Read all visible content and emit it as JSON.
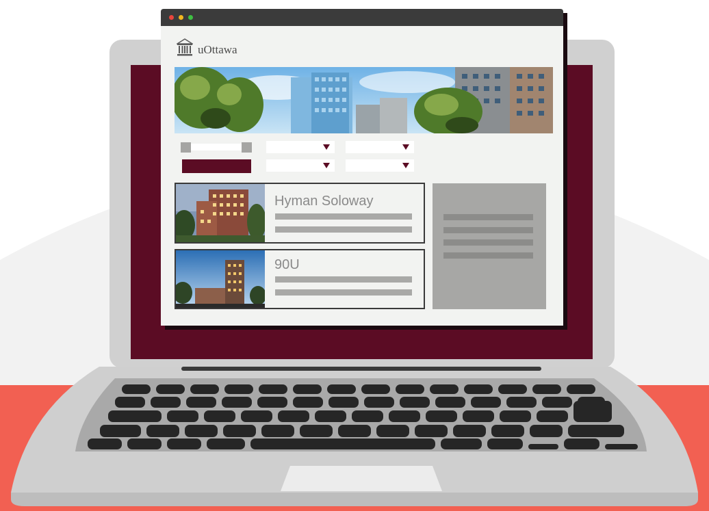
{
  "colors": {
    "accent_maroon": "#5b0c24",
    "coral": "#f26052",
    "laptop_gray": "#c9c9c9",
    "key_dark": "#262626"
  },
  "browser": {
    "window_buttons": [
      "close",
      "minimize",
      "maximize"
    ],
    "logo": {
      "icon": "building-columns-icon",
      "text": "uOttawa"
    },
    "filters": {
      "range_slider": {
        "label": "",
        "low": 0.0,
        "high": 1.0
      },
      "submit_button_label": "",
      "dropdowns": [
        {
          "name": "dropdown-1",
          "value": ""
        },
        {
          "name": "dropdown-2",
          "value": ""
        },
        {
          "name": "dropdown-3",
          "value": ""
        },
        {
          "name": "dropdown-4",
          "value": ""
        }
      ]
    },
    "listings": [
      {
        "title": "Hyman Soloway"
      },
      {
        "title": "90U"
      }
    ]
  }
}
